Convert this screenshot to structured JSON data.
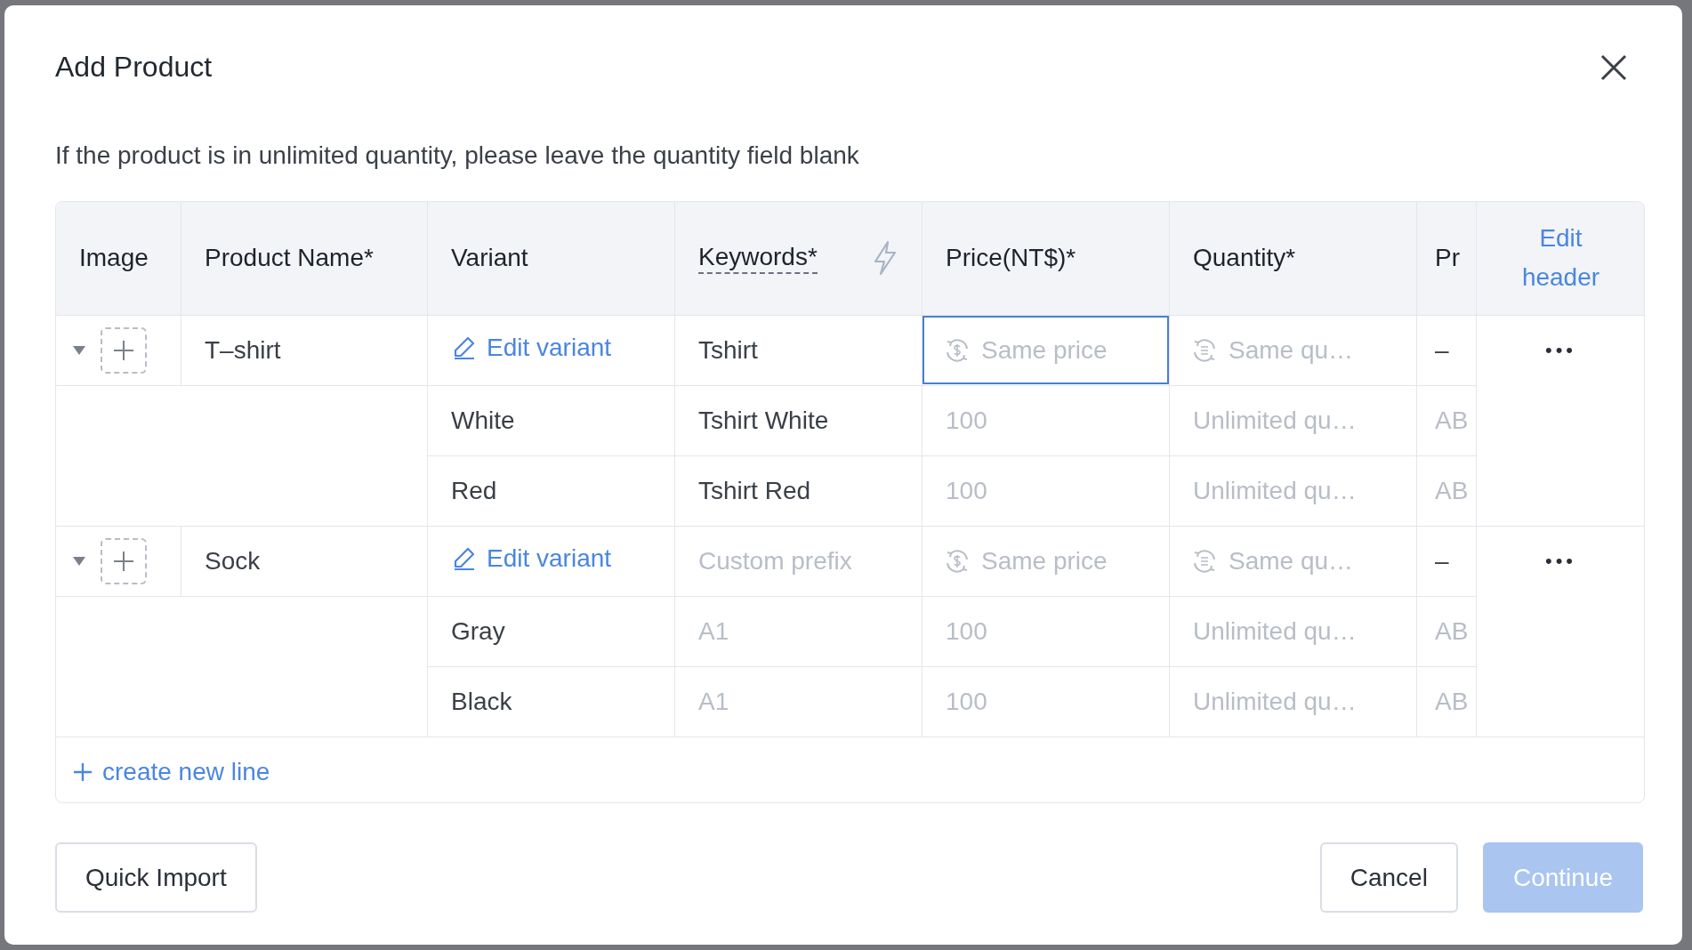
{
  "dialog": {
    "title": "Add Product",
    "hint": "If the product is in unlimited quantity, please leave the quantity field blank"
  },
  "table": {
    "columns": [
      {
        "kind": "plain",
        "label": "Image"
      },
      {
        "kind": "plain",
        "label": "Product Name*"
      },
      {
        "kind": "plain",
        "label": "Variant"
      },
      {
        "kind": "keywords",
        "label": "Keywords*"
      },
      {
        "kind": "plain",
        "label": "Price(NT$)*"
      },
      {
        "kind": "plain",
        "label": "Quantity*"
      },
      {
        "kind": "plain",
        "label": "Pr"
      }
    ],
    "edit_header": "Edit header",
    "products": [
      {
        "name": "T–shirt",
        "expanded": true,
        "variant_link": "Edit variant",
        "keywords": {
          "value": "Tshirt"
        },
        "price": {
          "placeholder": "Same price",
          "focused": true
        },
        "quantity": {
          "placeholder": "Same qu…",
          "focused": false
        },
        "column_7": "–",
        "more": "•••",
        "variants": [
          {
            "name": "White",
            "keywords": {
              "value": "Tshirt White"
            },
            "price": {
              "placeholder": "100"
            },
            "quantity": {
              "placeholder": "Unlimited qu…"
            },
            "column_7": "AB"
          },
          {
            "name": "Red",
            "keywords": {
              "value": "Tshirt Red"
            },
            "price": {
              "placeholder": "100"
            },
            "quantity": {
              "placeholder": "Unlimited qu…"
            },
            "column_7": "AB"
          }
        ]
      },
      {
        "name": "Sock",
        "expanded": true,
        "variant_link": "Edit variant",
        "keywords": {
          "placeholder": "Custom prefix"
        },
        "price": {
          "placeholder": "Same price",
          "focused": false
        },
        "quantity": {
          "placeholder": "Same qu…",
          "focused": false
        },
        "column_7": "–",
        "more": "•••",
        "variants": [
          {
            "name": "Gray",
            "keywords": {
              "placeholder": "A1"
            },
            "price": {
              "placeholder": "100"
            },
            "quantity": {
              "placeholder": "Unlimited qu…"
            },
            "column_7": "AB"
          },
          {
            "name": "Black",
            "keywords": {
              "placeholder": "A1"
            },
            "price": {
              "placeholder": "100"
            },
            "quantity": {
              "placeholder": "Unlimited qu…"
            },
            "column_7": "AB"
          }
        ]
      }
    ],
    "create_line": "create new line"
  },
  "buttons": [
    {
      "label": "Quick Import",
      "kind": "secondary",
      "disabled": false
    },
    {
      "label": "Cancel",
      "kind": "secondary",
      "disabled": false
    },
    {
      "label": "Continue",
      "kind": "primary",
      "disabled": true
    }
  ]
}
